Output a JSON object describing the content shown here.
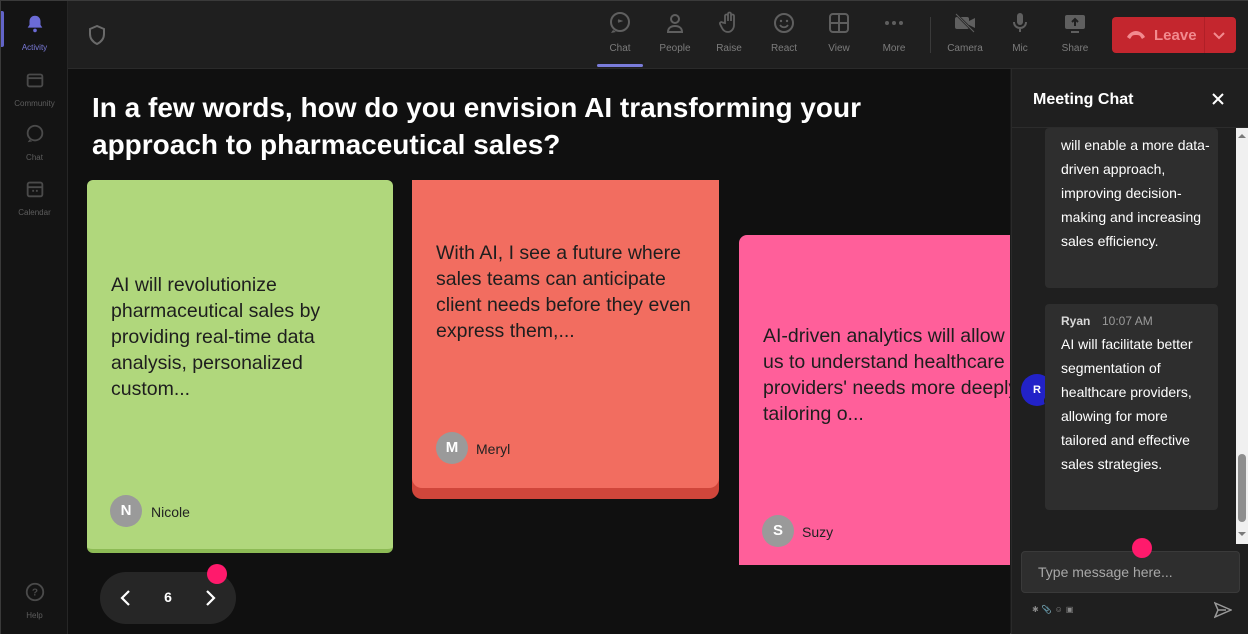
{
  "rail": {
    "items": [
      {
        "label": "Activity",
        "icon": "bell-icon"
      },
      {
        "label": "Community",
        "icon": "community-icon"
      },
      {
        "label": "Chat",
        "icon": "chat-icon"
      },
      {
        "label": "Calendar",
        "icon": "calendar-icon"
      },
      {
        "label": "Help",
        "icon": "help-icon"
      }
    ]
  },
  "toolbar": {
    "chat": "Chat",
    "people": "People",
    "raise": "Raise",
    "react": "React",
    "view": "View",
    "more": "More",
    "camera": "Camera",
    "mic": "Mic",
    "share": "Share",
    "leave": "Leave"
  },
  "stage": {
    "question": "In a few words, how do you envision AI transforming your approach to pharmaceutical sales?",
    "cards": [
      {
        "text": "AI will revolutionize pharmaceutical sales by providing real-time data analysis, personalized custom...",
        "author": "Nicole",
        "initial": "N",
        "color": "#b0d77c"
      },
      {
        "text": "With AI, I see a future where sales teams can anticipate client needs before they even express them,...",
        "author": "Meryl",
        "initial": "M",
        "color": "#f26d60"
      },
      {
        "text": "AI-driven analytics will allow us to understand healthcare providers' needs more deeply, tailoring o...",
        "author": "Suzy",
        "initial": "S",
        "color": "#ff5f9a"
      }
    ],
    "page_number": "6"
  },
  "chat": {
    "title": "Meeting Chat",
    "messages": [
      {
        "text": "will enable a more data-driven approach, improving decision-making and increasing sales efficiency."
      },
      {
        "sender": "Ryan",
        "initial": "R",
        "time": "10:07 AM",
        "text": "AI will facilitate better segmentation of healthcare providers, allowing for more tailored and effective sales strategies."
      }
    ],
    "input_placeholder": "Type message here..."
  },
  "colors": {
    "accent": "#6264c8",
    "leave": "#c4262e",
    "highlight_dot": "#ff1a6c"
  }
}
